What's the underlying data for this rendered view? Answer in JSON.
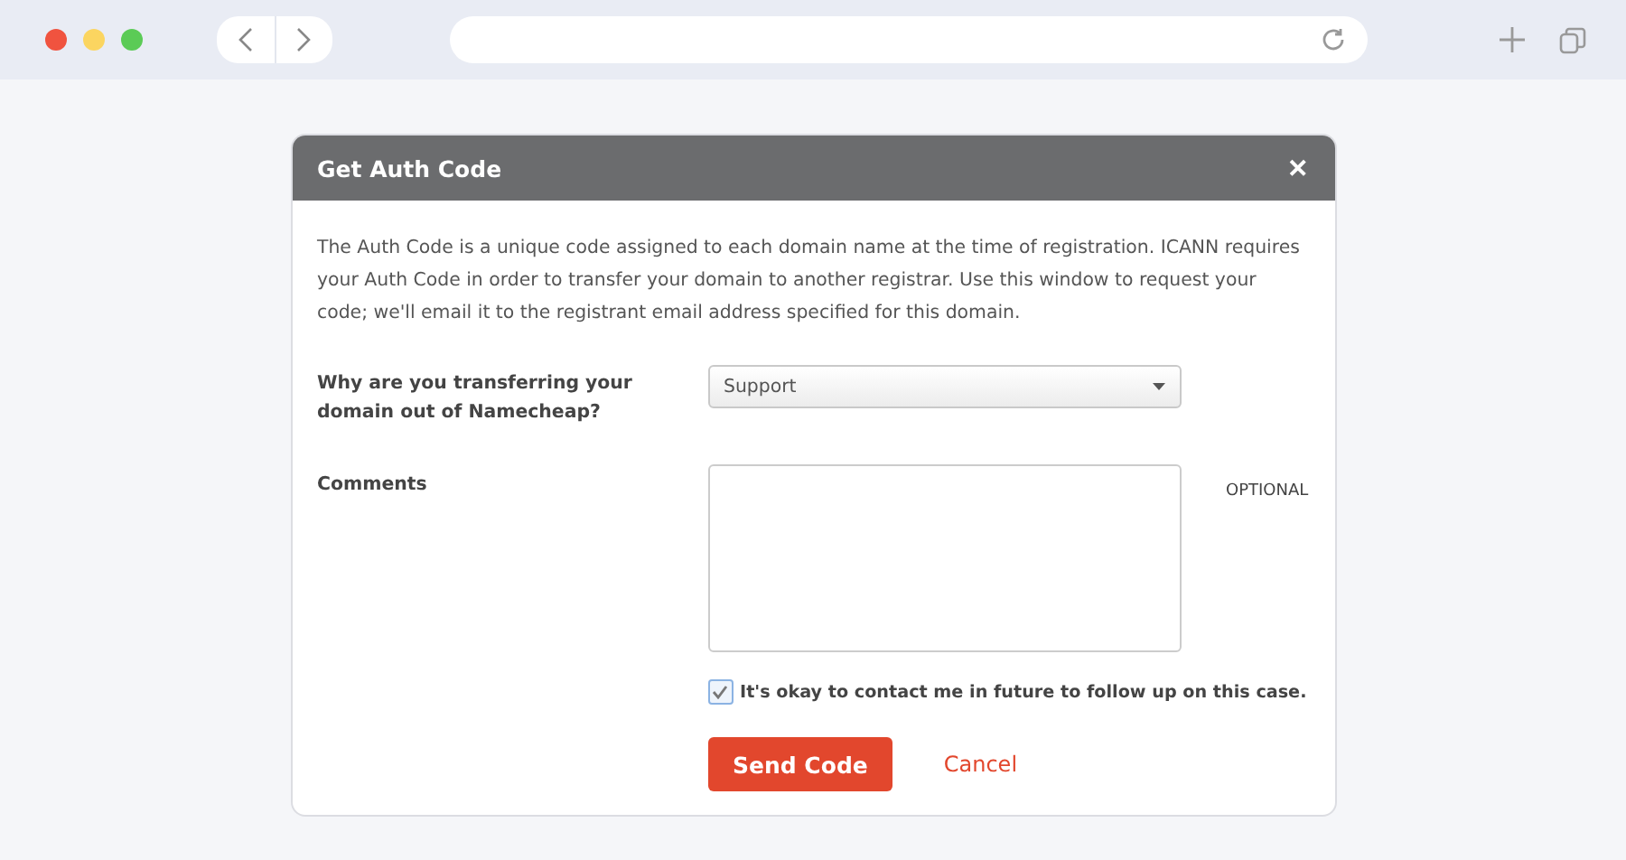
{
  "dialog": {
    "title": "Get Auth Code",
    "close": "✕",
    "intro": "The Auth Code is a unique code assigned to each domain name at the time of registration. ICANN requires your Auth Code in order to transfer your domain to another registrar. Use this window to request your code; we'll email it to the registrant email address specified for this domain.",
    "reason": {
      "label": "Why are you transferring your domain out of Namecheap?",
      "value": "Support"
    },
    "comments": {
      "label": "Comments",
      "hint": "OPTIONAL"
    },
    "contact": {
      "label": "It's okay to contact me in future to follow up on this case.",
      "checked": true
    },
    "buttons": {
      "send": "Send Code",
      "cancel": "Cancel"
    }
  }
}
